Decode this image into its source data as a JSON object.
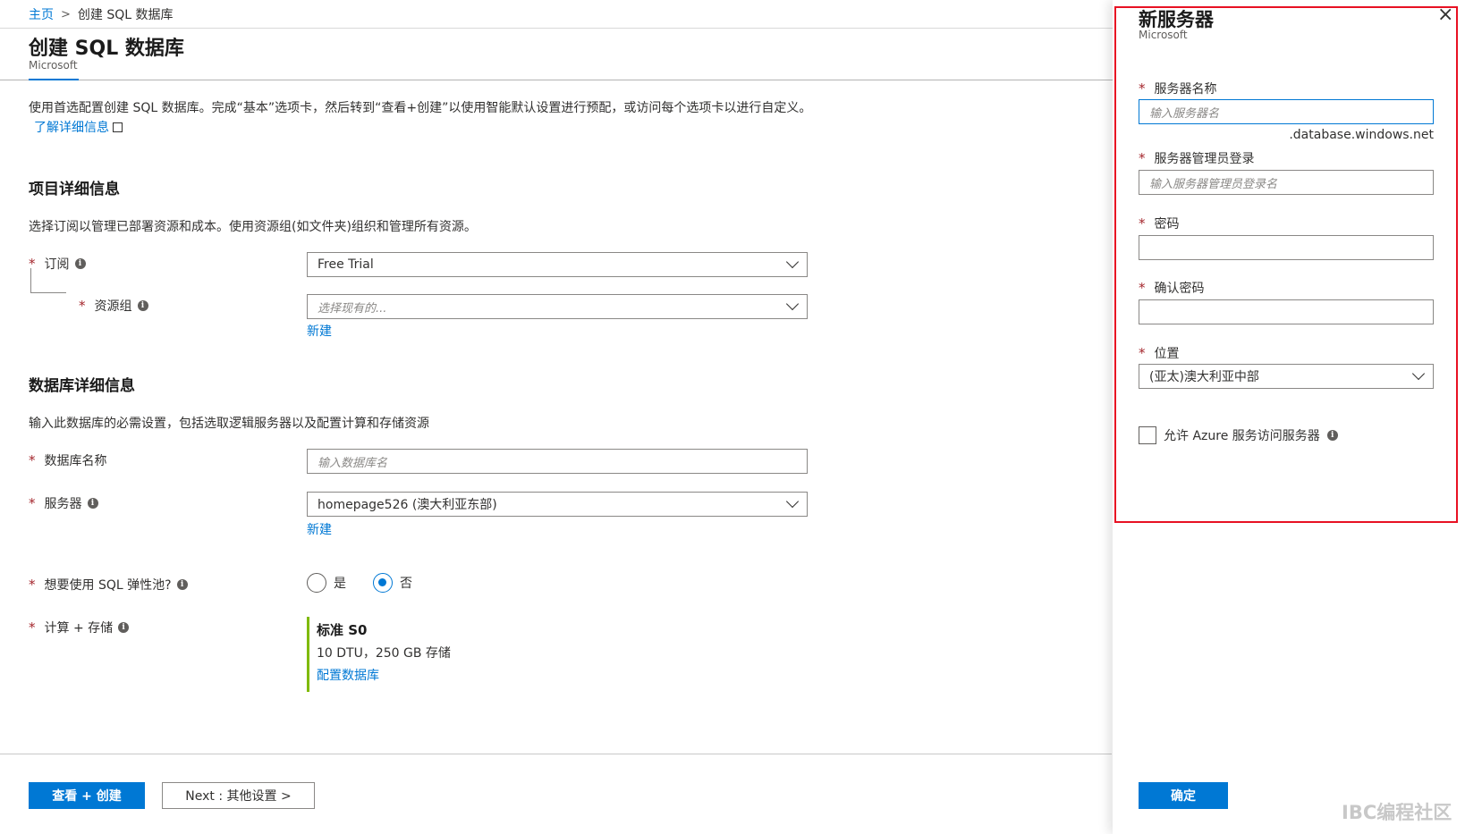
{
  "breadcrumb": {
    "home": "主页",
    "current": "创建 SQL 数据库"
  },
  "header": {
    "title": "创建 SQL 数据库",
    "subtitle": "Microsoft"
  },
  "intro": {
    "text": "使用首选配置创建 SQL 数据库。完成“基本”选项卡，然后转到“查看+创建”以使用智能默认设置进行预配，或访问每个选项卡以进行自定义。",
    "link": "了解详细信息"
  },
  "project": {
    "title": "项目详细信息",
    "description": "选择订阅以管理已部署资源和成本。使用资源组(如文件夹)组织和管理所有资源。",
    "subscription_label": "订阅",
    "subscription_value": "Free Trial",
    "resource_group_label": "资源组",
    "resource_group_placeholder": "选择现有的...",
    "new_link": "新建"
  },
  "database": {
    "title": "数据库详细信息",
    "description": "输入此数据库的必需设置，包括选取逻辑服务器以及配置计算和存储资源",
    "name_label": "数据库名称",
    "name_placeholder": "输入数据库名",
    "server_label": "服务器",
    "server_value": "homepage526 (澳大利亚东部)",
    "new_link": "新建",
    "elastic_label": "想要使用 SQL 弹性池?",
    "elastic_yes": "是",
    "elastic_no": "否",
    "elastic_selected": "否",
    "compute_label": "计算 + 存储",
    "tier_name": "标准 S0",
    "tier_detail": "10 DTU，250 GB 存储",
    "configure_link": "配置数据库"
  },
  "footer": {
    "review_button": "查看 + 创建",
    "next_button": "Next : 其他设置 >"
  },
  "panel": {
    "title": "新服务器",
    "subtitle": "Microsoft",
    "close_icon": "×",
    "server_name_label": "服务器名称",
    "server_name_placeholder": "输入服务器名",
    "domain_suffix": ".database.windows.net",
    "admin_label": "服务器管理员登录",
    "admin_placeholder": "输入服务器管理员登录名",
    "password_label": "密码",
    "confirm_label": "确认密码",
    "location_label": "位置",
    "location_value": "(亚太)澳大利亚中部",
    "allow_azure_label": "允许 Azure 服务访问服务器",
    "allow_azure_checked": false,
    "ok_button": "确定"
  },
  "watermark": "IBC编程社区",
  "colors": {
    "accent": "#0078d4",
    "required": "#a4262c",
    "tier_bar": "#7fba00",
    "highlight": "#e81123"
  }
}
